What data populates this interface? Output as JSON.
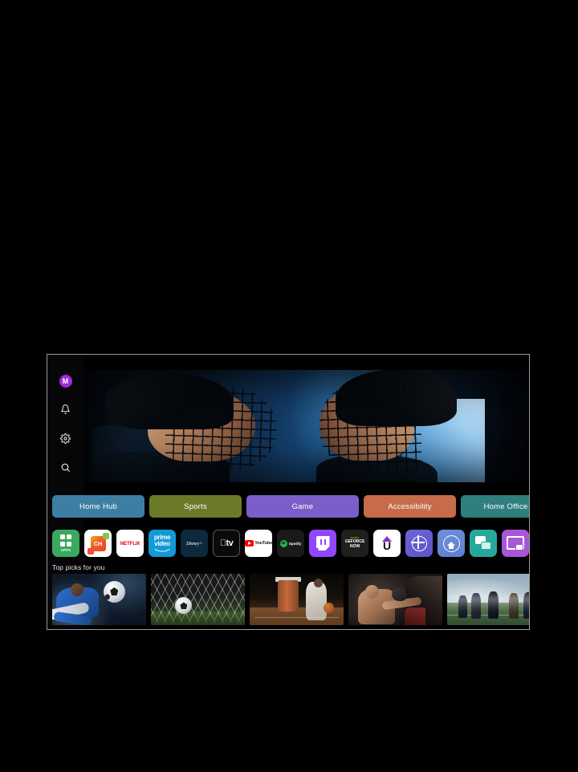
{
  "device": {
    "type": "smart-tv",
    "screen_background": "#000000",
    "bezel_color": "#9a9a9a"
  },
  "sidebar": {
    "avatar": {
      "initial": "M",
      "color": "#a029e0",
      "name": "profile-avatar"
    },
    "items": [
      {
        "icon": "bell-icon",
        "label": "Notifications"
      },
      {
        "icon": "gear-icon",
        "label": "Settings"
      },
      {
        "icon": "search-icon",
        "label": "Search"
      }
    ]
  },
  "hero": {
    "name": "hero-banner",
    "description": "Two ice hockey players face off wearing helmets with cage masks under blue arena lighting"
  },
  "tabs": [
    {
      "label": "Home Hub",
      "color": "#3d7fa3",
      "width": 115
    },
    {
      "label": "Sports",
      "color": "#6b7a28",
      "width": 115
    },
    {
      "label": "Game",
      "color": "#7b5ec7",
      "width": 140
    },
    {
      "label": "Accessibility",
      "color": "#c66c4a",
      "width": 115
    },
    {
      "label": "Home Office",
      "color": "#2e7f7d",
      "width": 112
    }
  ],
  "apps": [
    {
      "name": "apps-tile",
      "label": "APPS",
      "bg": "#3aa85e"
    },
    {
      "name": "samsung-tv-plus-tile",
      "label": "CH",
      "bg": "#ffffff"
    },
    {
      "name": "netflix-tile",
      "label": "NETFLIX",
      "bg": "#ffffff"
    },
    {
      "name": "prime-video-tile",
      "label": "prime video",
      "bg": "#1399d6"
    },
    {
      "name": "disney-plus-tile",
      "label": "Disney+",
      "bg": "#0c2a3c"
    },
    {
      "name": "apple-tv-tile",
      "label": "tv",
      "bg": "#0a0a0a"
    },
    {
      "name": "youtube-tile",
      "label": "YouTube",
      "bg": "#ffffff"
    },
    {
      "name": "spotify-tile",
      "label": "Spotify",
      "bg": "#1a1a1a"
    },
    {
      "name": "twitch-tile",
      "label": "Twitch",
      "bg": "#9146ff"
    },
    {
      "name": "geforce-now-tile",
      "label": "GEFORCE NOW",
      "bg": "#1f1f1f",
      "brand": "NVIDIA"
    },
    {
      "name": "universal-guide-tile",
      "label": "U",
      "bg": "#ffffff"
    },
    {
      "name": "internet-tile",
      "label": "Internet",
      "bg": "#6e63d8"
    },
    {
      "name": "smartthings-tile",
      "label": "SmartThings",
      "bg": "#6f8fd9"
    },
    {
      "name": "multi-view-tile",
      "label": "Multi View",
      "bg": "#27a89c"
    },
    {
      "name": "workspace-tile",
      "label": "Workspace",
      "bg": "#a855d6"
    }
  ],
  "sections": [
    {
      "title": "Top picks for you",
      "items": [
        {
          "name": "pick-soccer-kick",
          "caption": "Soccer player striking the ball"
        },
        {
          "name": "pick-goal-net",
          "caption": "Soccer ball in the goal net"
        },
        {
          "name": "pick-basketball",
          "caption": "Basketball player on an indoor court"
        },
        {
          "name": "pick-boxing",
          "caption": "Boxer throwing a punch"
        },
        {
          "name": "pick-football",
          "caption": "American football players on the field"
        }
      ]
    }
  ]
}
